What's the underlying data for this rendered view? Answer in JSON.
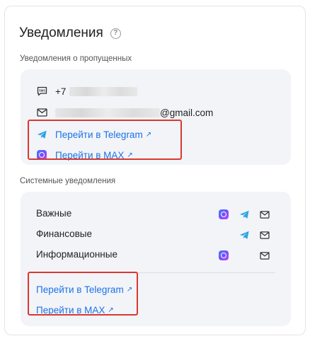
{
  "header": {
    "title": "Уведомления",
    "help_icon": "?"
  },
  "missed": {
    "section_label": "Уведомления о пропущенных",
    "phone_prefix": "+7",
    "email_suffix": "@gmail.com",
    "links": [
      {
        "label": "Перейти в Telegram",
        "icon": "telegram-icon"
      },
      {
        "label": "Перейти в MAX",
        "icon": "max-icon"
      }
    ]
  },
  "system": {
    "section_label": "Системные уведомления",
    "rows": [
      {
        "label": "Важные",
        "channels": [
          "max",
          "telegram",
          "email"
        ]
      },
      {
        "label": "Финансовые",
        "channels": [
          "telegram",
          "email"
        ]
      },
      {
        "label": "Информационные",
        "channels": [
          "max",
          "email"
        ]
      }
    ],
    "links": [
      {
        "label": "Перейти в Telegram"
      },
      {
        "label": "Перейти в MAX"
      }
    ]
  },
  "link_arrow": "↗",
  "colors": {
    "link": "#1a73e8",
    "highlight": "#d9382f",
    "panel": "#f3f4f8",
    "telegram": "#2aa3e6"
  }
}
